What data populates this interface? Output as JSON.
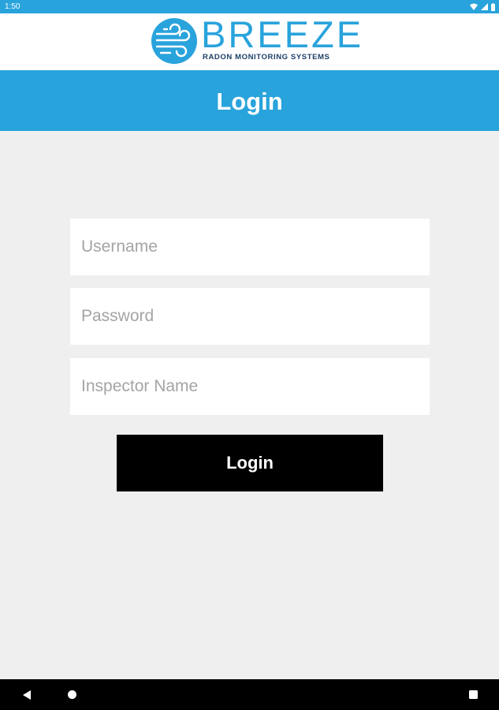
{
  "status_bar": {
    "time": "1:50",
    "icons": [
      "wifi-icon",
      "signal-icon",
      "battery-icon"
    ]
  },
  "logo": {
    "word": "BREEZE",
    "tagline": "RADON MONITORING SYSTEMS",
    "icon": "wind-icon"
  },
  "header": {
    "title": "Login"
  },
  "form": {
    "username": {
      "value": "",
      "placeholder": "Username"
    },
    "password": {
      "value": "",
      "placeholder": "Password"
    },
    "inspector_name": {
      "value": "",
      "placeholder": "Inspector Name"
    },
    "submit_label": "Login"
  },
  "nav_bar": {
    "buttons": [
      "back-icon",
      "home-icon",
      "recents-icon"
    ]
  },
  "colors": {
    "accent": "#29a3dc",
    "background": "#efefef",
    "button": "#000000",
    "logo_tagline": "#1c3f66"
  }
}
